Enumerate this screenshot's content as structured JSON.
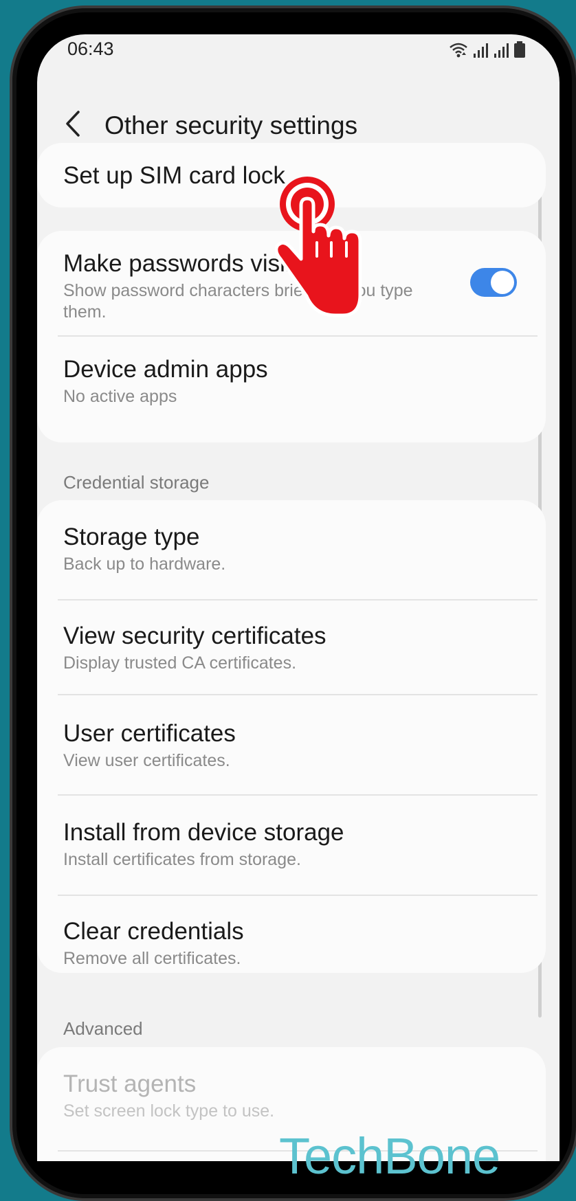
{
  "status_bar": {
    "time": "06:43",
    "icons": [
      "wifi-icon",
      "signal-icon",
      "signal-icon",
      "battery-icon"
    ]
  },
  "header": {
    "back_icon": "chevron-left-icon",
    "title": "Other security settings"
  },
  "sim_lock": {
    "title": "Set up SIM card lock"
  },
  "passwords": {
    "title": "Make passwords visible",
    "subtitle_line1": "Show password characters briefly as you type",
    "subtitle_line2": "them.",
    "toggle_on": true,
    "accent_color": "#3d86e8"
  },
  "device_admin": {
    "title": "Device admin apps",
    "subtitle": "No active apps"
  },
  "credential_storage": {
    "label": "Credential storage",
    "items": [
      {
        "title": "Storage type",
        "subtitle": "Back up to hardware."
      },
      {
        "title": "View security certificates",
        "subtitle": "Display trusted CA certificates."
      },
      {
        "title": "User certificates",
        "subtitle": "View user certificates."
      },
      {
        "title": "Install from device storage",
        "subtitle": "Install certificates from storage."
      },
      {
        "title": "Clear credentials",
        "subtitle": "Remove all certificates."
      }
    ]
  },
  "advanced": {
    "label": "Advanced",
    "items": [
      {
        "title": "Trust agents",
        "subtitle": "Set screen lock type to use."
      }
    ]
  },
  "overlay": {
    "tap_icon": "tap-hand-icon",
    "tap_color": "#e8141c"
  },
  "watermark": {
    "text": "TechBone",
    "color": "#5cc2cf"
  }
}
